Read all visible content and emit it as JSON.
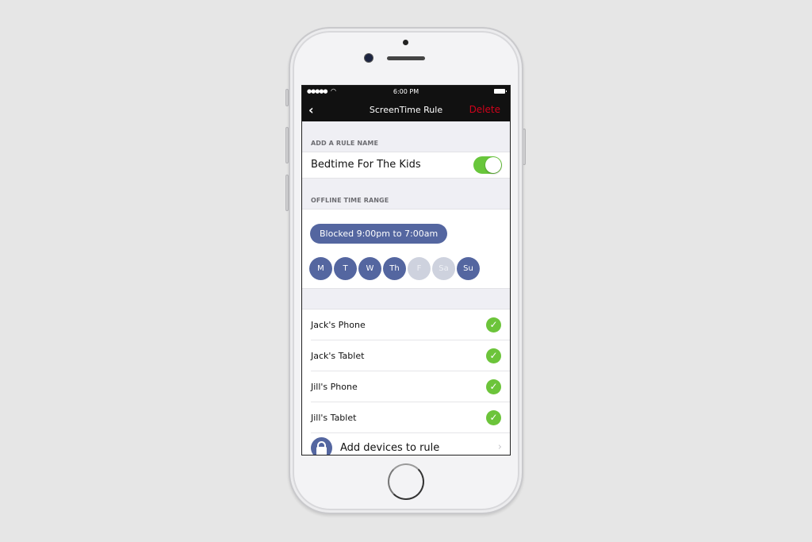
{
  "status_bar": {
    "signal": "●●●●●",
    "wifi_icon": "wifi-icon",
    "time": "6:00 PM",
    "battery_icon": "battery-icon"
  },
  "nav": {
    "back_icon": "chevron-left-icon",
    "back_glyph": "‹",
    "title": "ScreenTime Rule",
    "delete_label": "Delete"
  },
  "rule_name_section": {
    "header": "ADD A RULE NAME",
    "value": "Bedtime For The Kids",
    "enabled": true
  },
  "time_range_section": {
    "header": "OFFLINE TIME RANGE",
    "range_label": "Blocked 9:00pm to 7:00am",
    "days": [
      {
        "label": "M",
        "active": true
      },
      {
        "label": "T",
        "active": true
      },
      {
        "label": "W",
        "active": true
      },
      {
        "label": "Th",
        "active": true
      },
      {
        "label": "F",
        "active": false
      },
      {
        "label": "Sa",
        "active": false
      },
      {
        "label": "Su",
        "active": true
      }
    ]
  },
  "devices": [
    {
      "name": "Jack's Phone",
      "selected": true
    },
    {
      "name": "Jack's Tablet",
      "selected": true
    },
    {
      "name": "Jill's Phone",
      "selected": true
    },
    {
      "name": "Jill's Tablet",
      "selected": true
    }
  ],
  "add_devices": {
    "label": "Add devices to rule",
    "icon": "lock-icon",
    "chevron": "›"
  },
  "check_glyph": "✓",
  "colors": {
    "accent": "#5466a0",
    "toggle_on": "#68c63b",
    "check": "#6cc43a",
    "delete": "#d0021b",
    "day_inactive": "#ced2de"
  }
}
